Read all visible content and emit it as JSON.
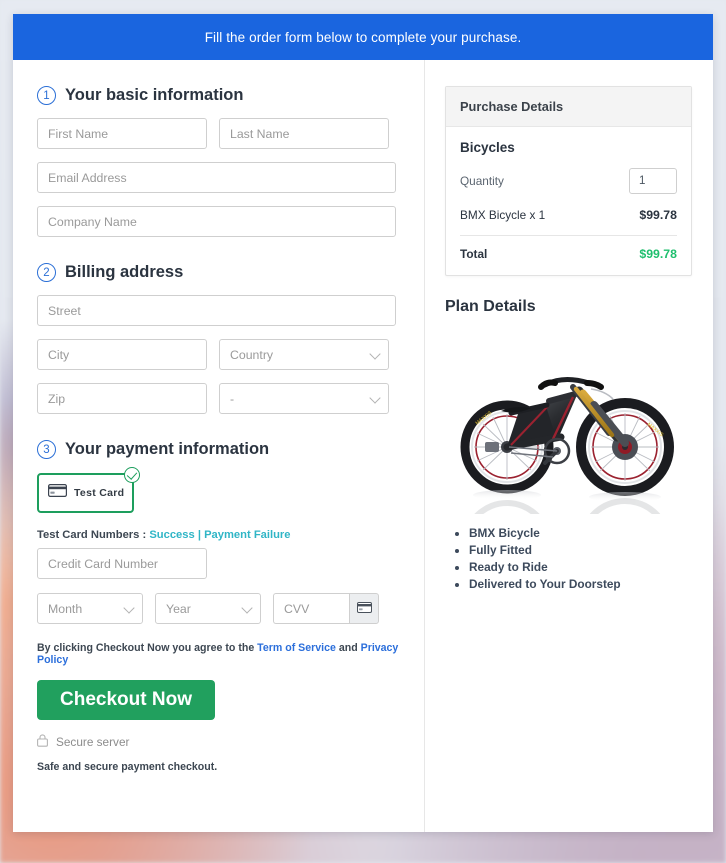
{
  "banner": {
    "text": "Fill the order form below to complete your purchase."
  },
  "sections": {
    "basic": {
      "number": "1",
      "title": "Your basic information"
    },
    "billing": {
      "number": "2",
      "title": "Billing address"
    },
    "payment": {
      "number": "3",
      "title": "Your payment information"
    }
  },
  "fields": {
    "first_name": "First Name",
    "last_name": "Last Name",
    "email": "Email Address",
    "company": "Company Name",
    "street": "Street",
    "city": "City",
    "country": "Country",
    "zip": "Zip",
    "state": "-",
    "credit_card": "Credit Card Number",
    "month": "Month",
    "year": "Year",
    "cvv": "CVV"
  },
  "payment": {
    "card_tile_label": "Test Card",
    "card_tile_icon": "credit-card-icon",
    "selected_badge": "check-circle-icon",
    "test_numbers_prefix": "Test Card Numbers :",
    "link_success": "Success",
    "link_divider": "|",
    "link_failure": "Payment Failure",
    "cvv_icon": "credit-card-icon"
  },
  "terms": {
    "prefix": "By clicking Checkout Now you agree to the",
    "tos": "Term of Service",
    "and": "and",
    "privacy": "Privacy Policy"
  },
  "checkout": {
    "label": "Checkout Now"
  },
  "secure": {
    "icon": "lock-icon",
    "label": "Secure server"
  },
  "footer_note": "Safe and secure payment checkout.",
  "purchase_details": {
    "header": "Purchase Details",
    "category": "Bicycles",
    "quantity_label": "Quantity",
    "quantity_value": "1",
    "item_label": "BMX Bicycle x 1",
    "item_price": "$99.78",
    "total_label": "Total",
    "total_price": "$99.78"
  },
  "plan": {
    "title": "Plan Details",
    "image_alt": "bicycle-photo",
    "features": [
      "BMX Bicycle",
      "Fully Fitted",
      "Ready to Ride",
      "Delivered to Your Doorstep"
    ]
  },
  "colors": {
    "banner_blue": "#1a65df",
    "accent_green": "#21a05e",
    "total_green": "#1fbf6e",
    "link_teal": "#2fb5c6",
    "link_blue": "#2c6fdb"
  }
}
